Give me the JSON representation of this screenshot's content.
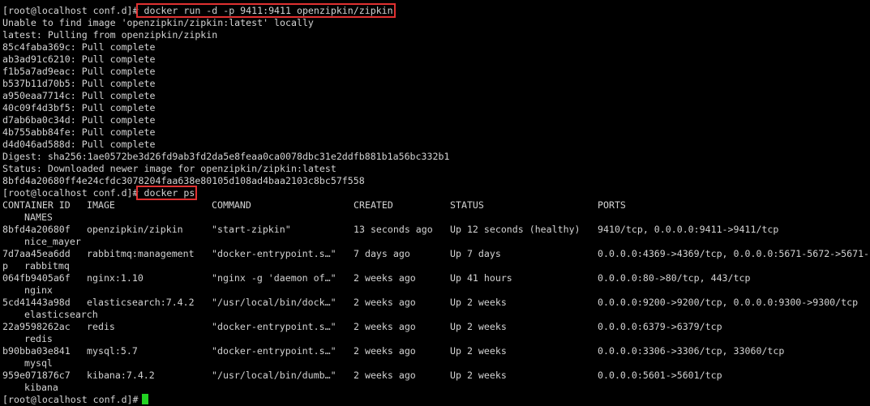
{
  "prompt": "[root@localhost conf.d]#",
  "commands": {
    "run": " docker run -d -p 9411:9411 openzipkin/zipkin",
    "ps": " docker ps"
  },
  "output_lines": [
    "Unable to find image 'openzipkin/zipkin:latest' locally",
    "latest: Pulling from openzipkin/zipkin",
    "85c4faba369c: Pull complete",
    "ab3ad91c6210: Pull complete",
    "f1b5a7ad9eac: Pull complete",
    "b537b11d70b5: Pull complete",
    "a950eaa7714c: Pull complete",
    "40c09f4d3bf5: Pull complete",
    "d7ab6ba0c34d: Pull complete",
    "4b755abb84fe: Pull complete",
    "d4d046ad588d: Pull complete",
    "Digest: sha256:1ae0572be3d26fd9ab3fd2da5e8feaa0ca0078dbc31e2ddfb881b1a56bc332b1",
    "Status: Downloaded newer image for openzipkin/zipkin:latest",
    "8bfd4a20680ff4e24cfdc3078204faa638e80105d108ad4baa2103c8bc57f558"
  ],
  "ps_headers": {
    "container_id": "CONTAINER ID",
    "image": "IMAGE",
    "command": "COMMAND",
    "created": "CREATED",
    "status": "STATUS",
    "ports": "PORTS",
    "names": "NAMES"
  },
  "containers": [
    {
      "id": "8bfd4a20680f",
      "image": "openzipkin/zipkin",
      "command": "\"start-zipkin\"",
      "created": "13 seconds ago",
      "status": "Up 12 seconds (healthy)",
      "ports": "9410/tcp, 0.0.0.0:9411->9411/tcp",
      "wrap": "",
      "name": "nice_mayer"
    },
    {
      "id": "7d7aa45ea6dd",
      "image": "rabbitmq:management",
      "command": "\"docker-entrypoint.s…\"",
      "created": "7 days ago",
      "status": "Up 7 days",
      "ports": "0.0.0.0:4369->4369/tcp, 0.0.0.0:5671-5672->5671-",
      "wrap": "p",
      "name": "rabbitmq"
    },
    {
      "id": "064fb9405a6f",
      "image": "nginx:1.10",
      "command": "\"nginx -g 'daemon of…\"",
      "created": "2 weeks ago",
      "status": "Up 41 hours",
      "ports": "0.0.0.0:80->80/tcp, 443/tcp",
      "wrap": "",
      "name": "nginx"
    },
    {
      "id": "5cd41443a98d",
      "image": "elasticsearch:7.4.2",
      "command": "\"/usr/local/bin/dock…\"",
      "created": "2 weeks ago",
      "status": "Up 2 weeks",
      "ports": "0.0.0.0:9200->9200/tcp, 0.0.0.0:9300->9300/tcp",
      "wrap": "",
      "name": "elasticsearch"
    },
    {
      "id": "22a9598262ac",
      "image": "redis",
      "command": "\"docker-entrypoint.s…\"",
      "created": "2 weeks ago",
      "status": "Up 2 weeks",
      "ports": "0.0.0.0:6379->6379/tcp",
      "wrap": "",
      "name": "redis"
    },
    {
      "id": "b90bba03e841",
      "image": "mysql:5.7",
      "command": "\"docker-entrypoint.s…\"",
      "created": "2 weeks ago",
      "status": "Up 2 weeks",
      "ports": "0.0.0.0:3306->3306/tcp, 33060/tcp",
      "wrap": "",
      "name": "mysql"
    },
    {
      "id": "959e071876c7",
      "image": "kibana:7.4.2",
      "command": "\"/usr/local/bin/dumb…\"",
      "created": "2 weeks ago",
      "status": "Up 2 weeks",
      "ports": "0.0.0.0:5601->5601/tcp",
      "wrap": "",
      "name": "kibana"
    }
  ],
  "colors": {
    "background": "#000000",
    "text": "#d3d3d3",
    "highlight_box": "#e03131",
    "cursor": "#22d322"
  }
}
